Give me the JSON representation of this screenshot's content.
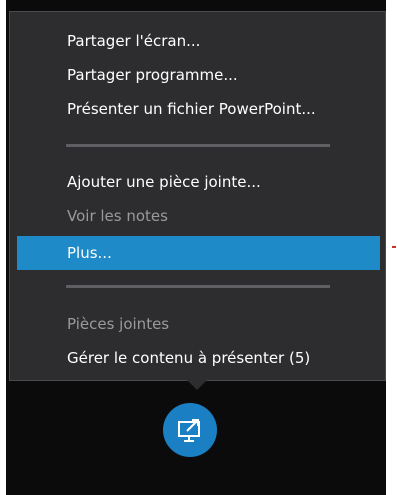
{
  "menu": {
    "items": [
      {
        "label": "Partager l'écran...",
        "state": "enabled"
      },
      {
        "label": "Partager programme...",
        "state": "enabled"
      },
      {
        "label": "Présenter un fichier PowerPoint...",
        "state": "enabled"
      },
      {
        "label": "Ajouter une pièce jointe...",
        "state": "enabled"
      },
      {
        "label": "Voir les notes",
        "state": "disabled"
      },
      {
        "label": "Plus...",
        "state": "highlighted"
      },
      {
        "label": "Pièces jointes",
        "state": "disabled"
      },
      {
        "label": "Gérer le contenu à présenter (5)",
        "state": "enabled"
      }
    ]
  },
  "share_button": {
    "icon": "present-screen-icon"
  },
  "colors": {
    "menu_background": "#2d2d30",
    "highlight": "#1e8ac8",
    "button": "#1b7fc3",
    "disabled_text": "#9a9a9a"
  }
}
